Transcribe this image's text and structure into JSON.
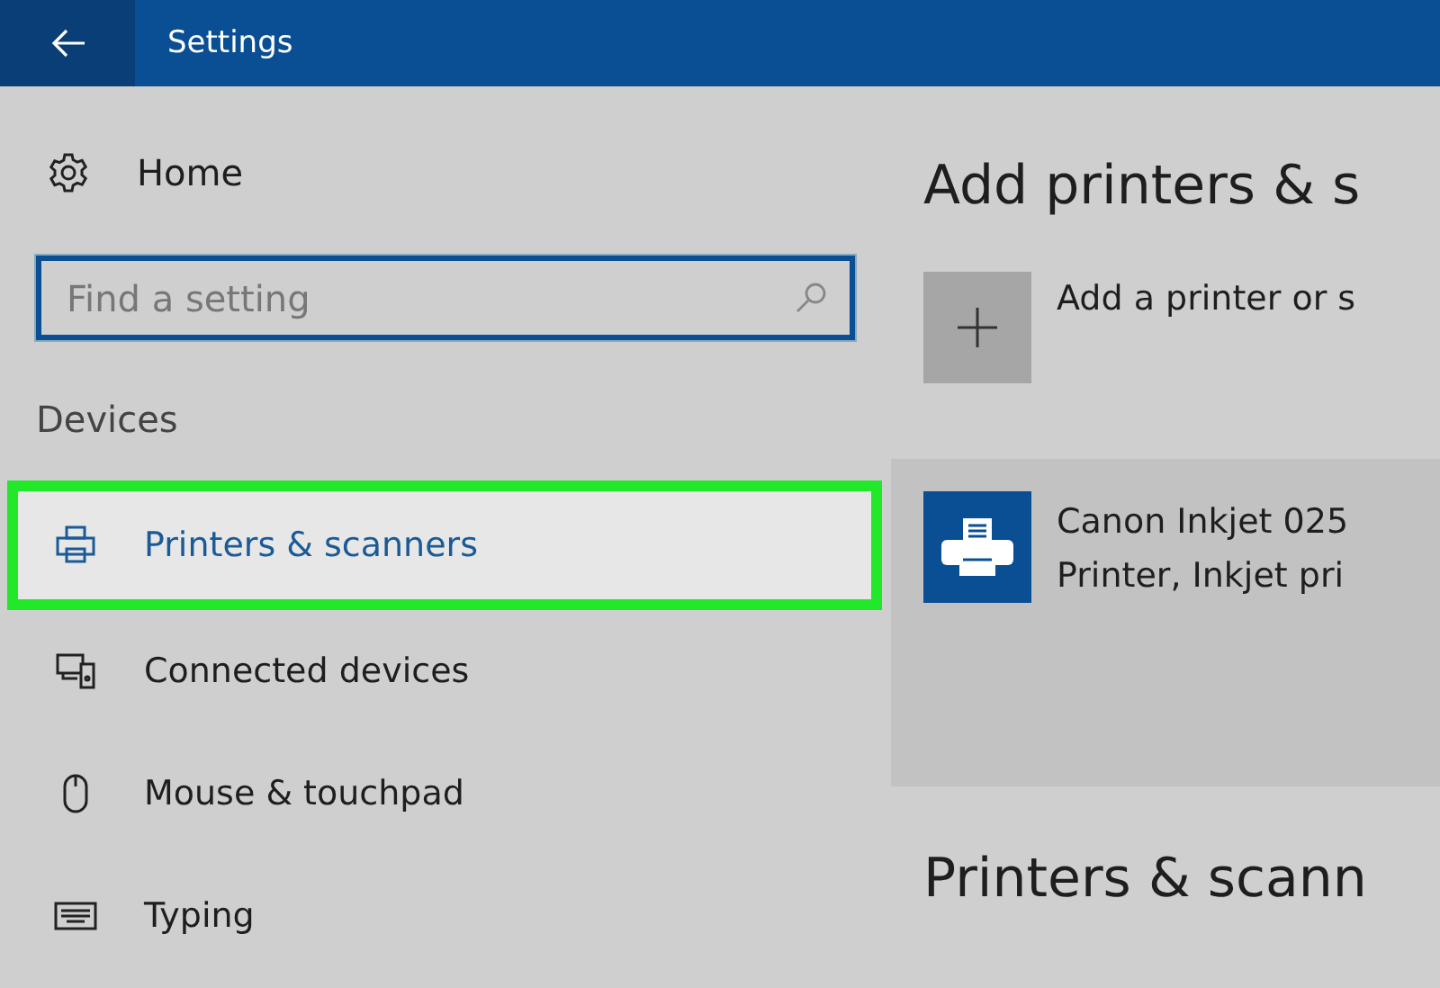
{
  "window": {
    "title": "Settings"
  },
  "sidebar": {
    "home": "Home",
    "search": {
      "placeholder": "Find a setting"
    },
    "section": "Devices",
    "items": [
      {
        "label": "Printers & scanners",
        "selected": true
      },
      {
        "label": "Connected devices",
        "selected": false
      },
      {
        "label": "Mouse & touchpad",
        "selected": false
      },
      {
        "label": "Typing",
        "selected": false
      }
    ]
  },
  "main": {
    "heading": "Add printers & s",
    "add_label": "Add a printer or s",
    "printer": {
      "name": "Canon Inkjet 025",
      "description": "Printer, Inkjet pri"
    },
    "list_heading": "Printers & scann"
  }
}
